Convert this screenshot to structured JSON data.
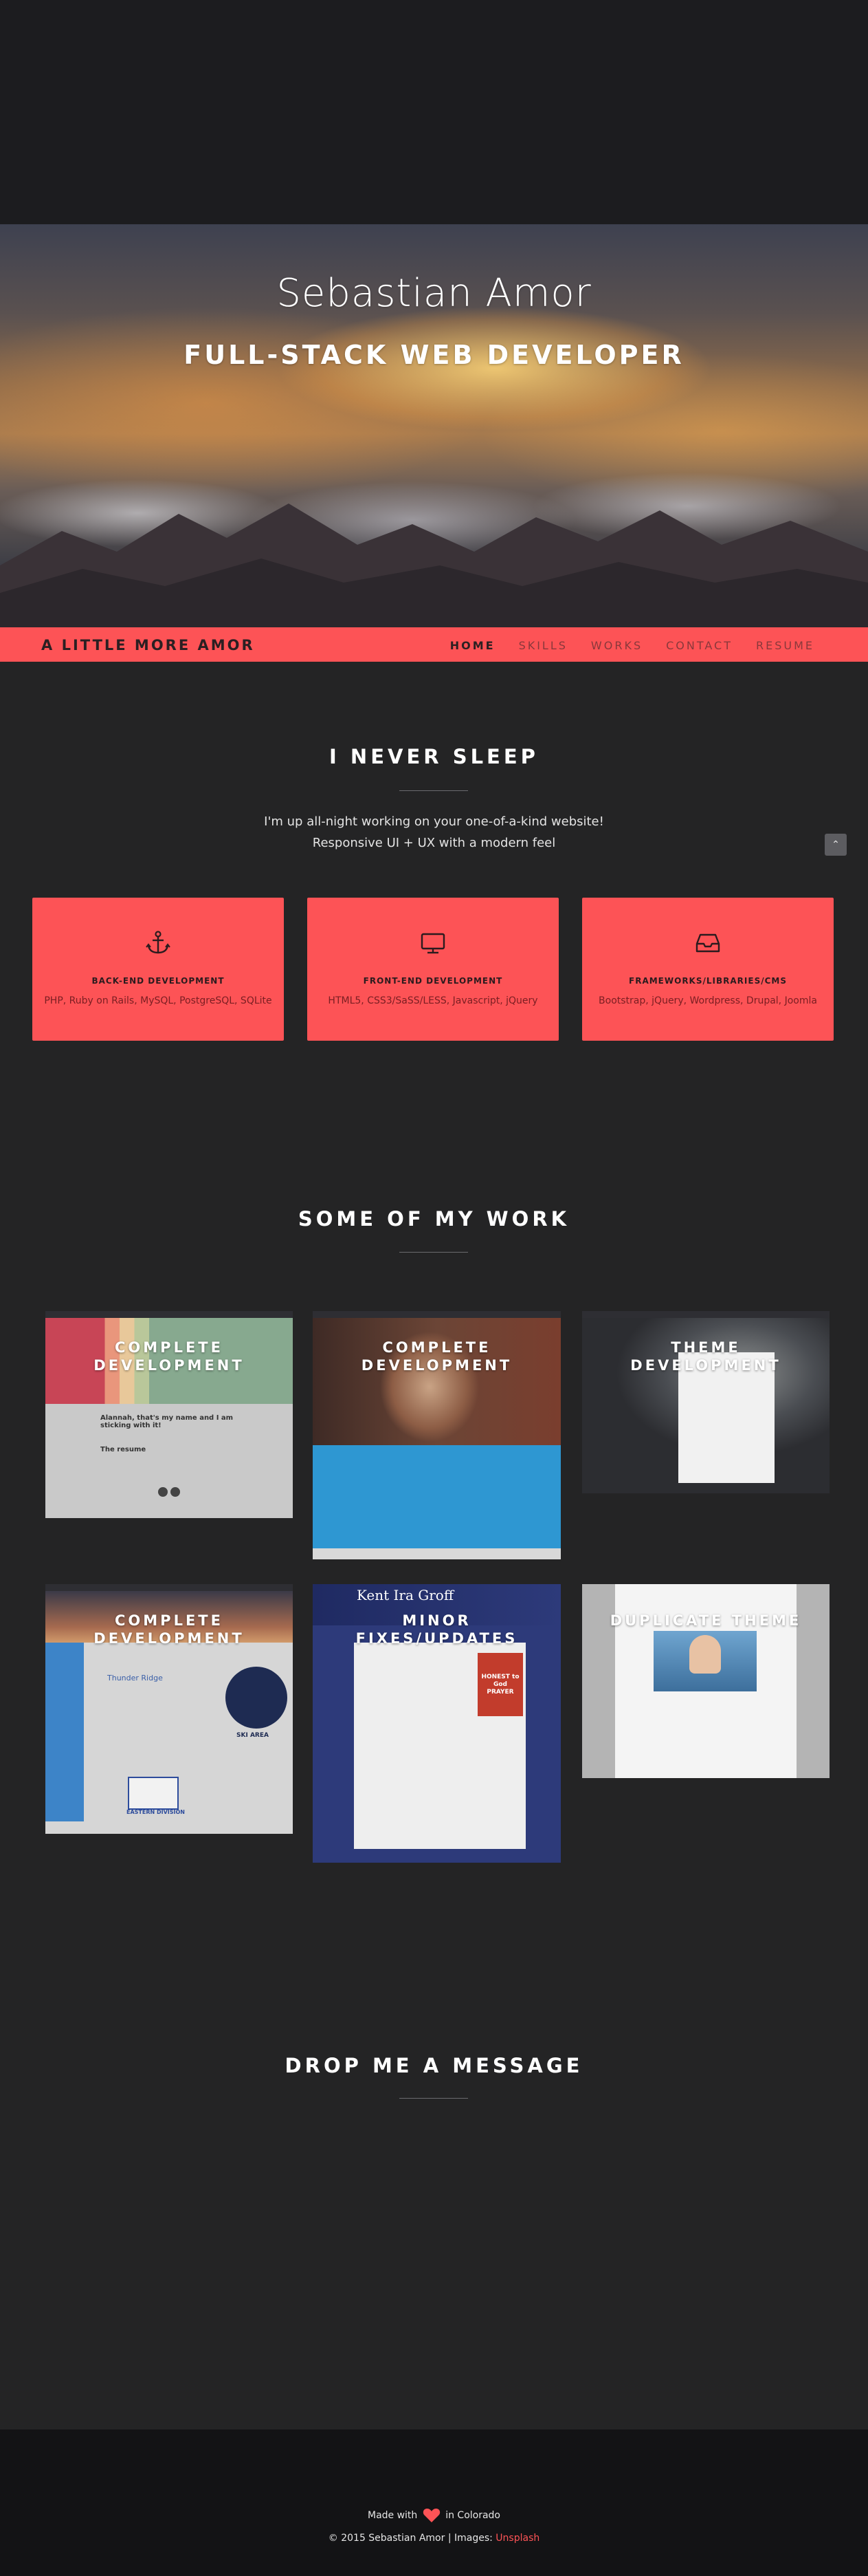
{
  "hero": {
    "name": "Sebastian Amor",
    "title": "FULL-STACK WEB DEVELOPER"
  },
  "navbar": {
    "brand": "A LITTLE MORE AMOR",
    "links": [
      "HOME",
      "SKILLS",
      "WORKS",
      "CONTACT",
      "RESUME"
    ],
    "active": "HOME"
  },
  "skills": {
    "heading": "I NEVER SLEEP",
    "intro_line_1": "I'm up all-night working on your one-of-a-kind website!",
    "intro_line_2": "Responsive UI + UX with a modern feel",
    "scroll_top_icon": "chevron-up-icon",
    "cards": [
      {
        "icon": "anchor-icon",
        "title": "BACK-END DEVELOPMENT",
        "text": "PHP, Ruby on Rails, MySQL, PostgreSQL, SQLite"
      },
      {
        "icon": "monitor-icon",
        "title": "FRONT-END DEVELOPMENT",
        "text": "HTML5, CSS3/SaSS/LESS, Javascript, jQuery"
      },
      {
        "icon": "inbox-icon",
        "title": "FRAMEWORKS/LIBRARIES/CMS",
        "text": "Bootstrap, jQuery, Wordpress, Drupal, Joomla"
      }
    ]
  },
  "works": {
    "heading": "SOME OF MY WORK",
    "items": [
      {
        "caption_1": "COMPLETE",
        "caption_2": "DEVELOPMENT",
        "text_1": "Alannah, that's my name and I am sticking with it!",
        "text_2": "The resume"
      },
      {
        "caption_1": "COMPLETE",
        "caption_2": "DEVELOPMENT"
      },
      {
        "caption_1": "THEME",
        "caption_2": "DEVELOPMENT"
      },
      {
        "caption_1": "COMPLETE",
        "caption_2": "DEVELOPMENT",
        "text_1": "Thunder Ridge",
        "text_2": "SKI AREA",
        "text_3": "EASTERN DIVISION"
      },
      {
        "caption_1": "MINOR",
        "caption_2": "FIXES/UPDATES",
        "text_1": "Kent Ira Groff",
        "text_2": "HONEST to God PRAYER"
      },
      {
        "caption_1": "DUPLICATE THEME",
        "caption_2": ""
      }
    ]
  },
  "contact": {
    "heading": "DROP ME A MESSAGE"
  },
  "footer": {
    "made_with_prefix": "Made with",
    "made_with_suffix": "in Colorado",
    "copyright_prefix": "© 2015 Sebastian Amor | Images: ",
    "images_link": "Unsplash"
  },
  "colors": {
    "accent": "#fd5356",
    "background": "#242425",
    "footer": "#131315",
    "top_band": "#1c1c1f"
  }
}
